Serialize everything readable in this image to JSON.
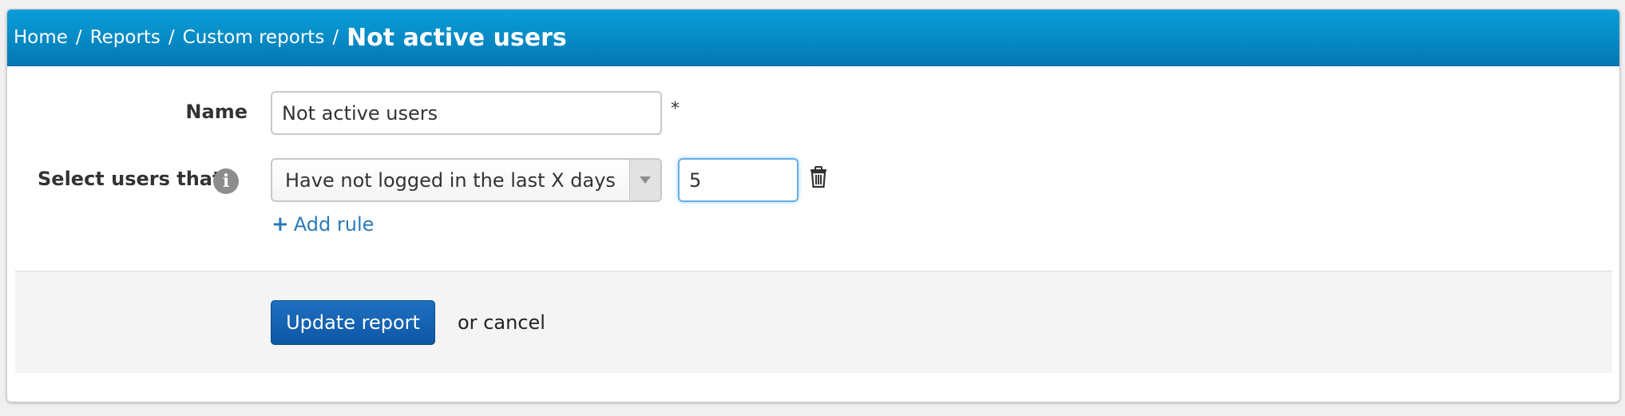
{
  "breadcrumb": {
    "items": [
      "Home",
      "Reports",
      "Custom reports"
    ],
    "separator": "/",
    "current": "Not active users"
  },
  "form": {
    "name_label": "Name",
    "name_value": "Not active users",
    "required_marker": "*",
    "select_label": "Select users that",
    "info_icon": "i",
    "rule_select_value": "Have not logged in the last X days",
    "rule_days_value": "5",
    "add_rule_icon": "+",
    "add_rule_label": "Add rule"
  },
  "actions": {
    "submit_label": "Update report",
    "or_text": "or",
    "cancel_label": "cancel"
  },
  "colors": {
    "header": "#0689c4",
    "link": "#2a7ab8",
    "primary_button": "#0d57a5"
  }
}
